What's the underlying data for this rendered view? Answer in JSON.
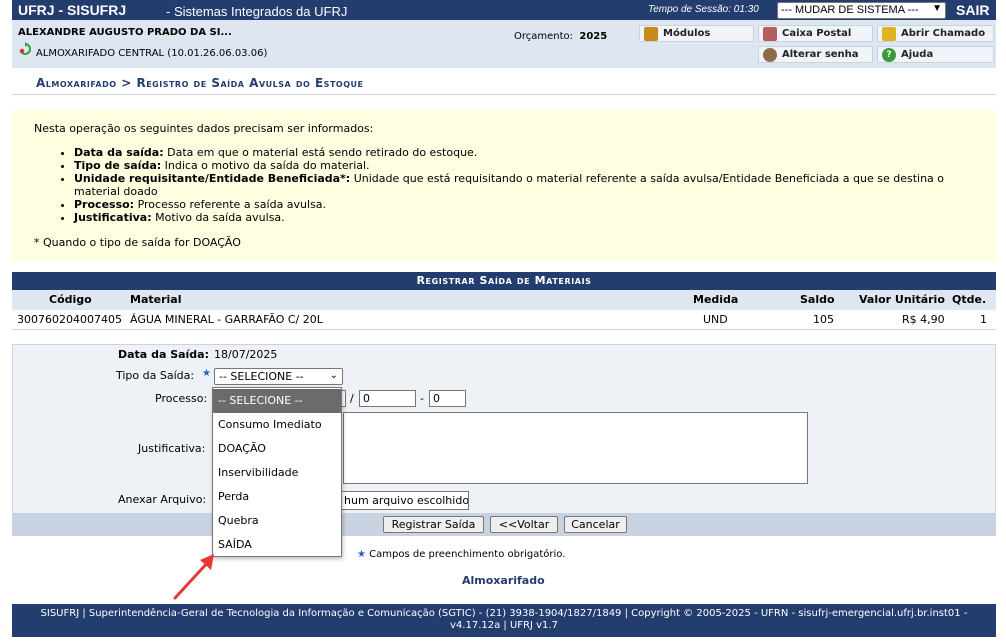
{
  "top": {
    "title": "UFRJ - SISUFRJ",
    "subtitle": "- Sistemas Integrados da UFRJ",
    "session_label": "Tempo de Sessão: 01:30",
    "system_select": "--- MUDAR DE SISTEMA ---",
    "exit_label": "SAIR"
  },
  "user": {
    "name": "ALEXANDRE AUGUSTO PRADO DA SI...",
    "unit": "ALMOXARIFADO CENTRAL (10.01.26.06.03.06)",
    "budget_label": "Orçamento:",
    "budget_year": "2025"
  },
  "quick_buttons": {
    "modulos": "Módulos",
    "caixa_postal": "Caixa Postal",
    "abrir_chamado": "Abrir Chamado",
    "alterar_senha": "Alterar senha",
    "ajuda": "Ajuda"
  },
  "breadcrumb": "Almoxarifado > Registro de Saída Avulsa do Estoque",
  "info": {
    "intro": "Nesta operação os seguintes dados precisam ser informados:",
    "items": [
      {
        "term": "Data da saída:",
        "desc": " Data em que o material está sendo retirado do estoque."
      },
      {
        "term": "Tipo de saída:",
        "desc": " Indica o motivo da saída do material."
      },
      {
        "term": "Unidade requisitante/Entidade Beneficiada*:",
        "desc": " Unidade que está requisitando o material referente a saída avulsa/Entidade Beneficiada a que se destina o material doado"
      },
      {
        "term": "Processo:",
        "desc": " Processo referente a saída avulsa."
      },
      {
        "term": "Justificativa:",
        "desc": " Motivo da saída avulsa."
      }
    ],
    "footnote": "* Quando o tipo de saída for DOAÇÃO"
  },
  "table": {
    "caption": "Registrar Saída de Materiais",
    "columns": [
      "Código",
      "Material",
      "Medida",
      "Saldo",
      "Valor Unitário",
      "Qtde."
    ],
    "rows": [
      {
        "codigo": "300760204007405",
        "material": "ÁGUA MINERAL - GARRAFÃO C/ 20L",
        "medida": "UND",
        "saldo": "105",
        "valor": "R$ 4,90",
        "qtde": "1"
      }
    ]
  },
  "form": {
    "data_label": "Data da Saída:",
    "data_value": "18/07/2025",
    "tipo_label": "Tipo da Saída:",
    "tipo_value": "-- SELECIONE --",
    "processo_label": "Processo:",
    "processo_num2": "0",
    "processo_num3": "0",
    "processo_sep1": "/",
    "processo_sep2": "-",
    "justificativa_label": "Justificativa:",
    "anexar_label": "Anexar Arquivo:",
    "file_text": "hum arquivo escolhido",
    "btn_registrar": "Registrar Saída",
    "btn_voltar": "<<Voltar",
    "btn_cancelar": "Cancelar"
  },
  "dropdown_options": [
    "-- SELECIONE --",
    "Consumo Imediato",
    "DOAÇÃO",
    "Inservibilidade",
    "Perda",
    "Quebra",
    "SAÍDA"
  ],
  "required_note": "Campos de preenchimento obrigatório.",
  "almox_link": "Almoxarifado",
  "footer": {
    "line1": "SISUFRJ | Superintendência-Geral de Tecnologia da Informação e Comunicação (SGTIC) - (21) 3938-1904/1827/1849 | Copyright © 2005-2025 - UFRN - sisufrj-emergencial.ufrj.br.inst01 -",
    "line2": "v4.17.12a | UFRJ v1.7"
  },
  "colors": {
    "header_blue": "#233d6f",
    "light_band": "#dee6f1",
    "info_bg": "#fefee1",
    "annotation_arrow": "#e53935"
  }
}
